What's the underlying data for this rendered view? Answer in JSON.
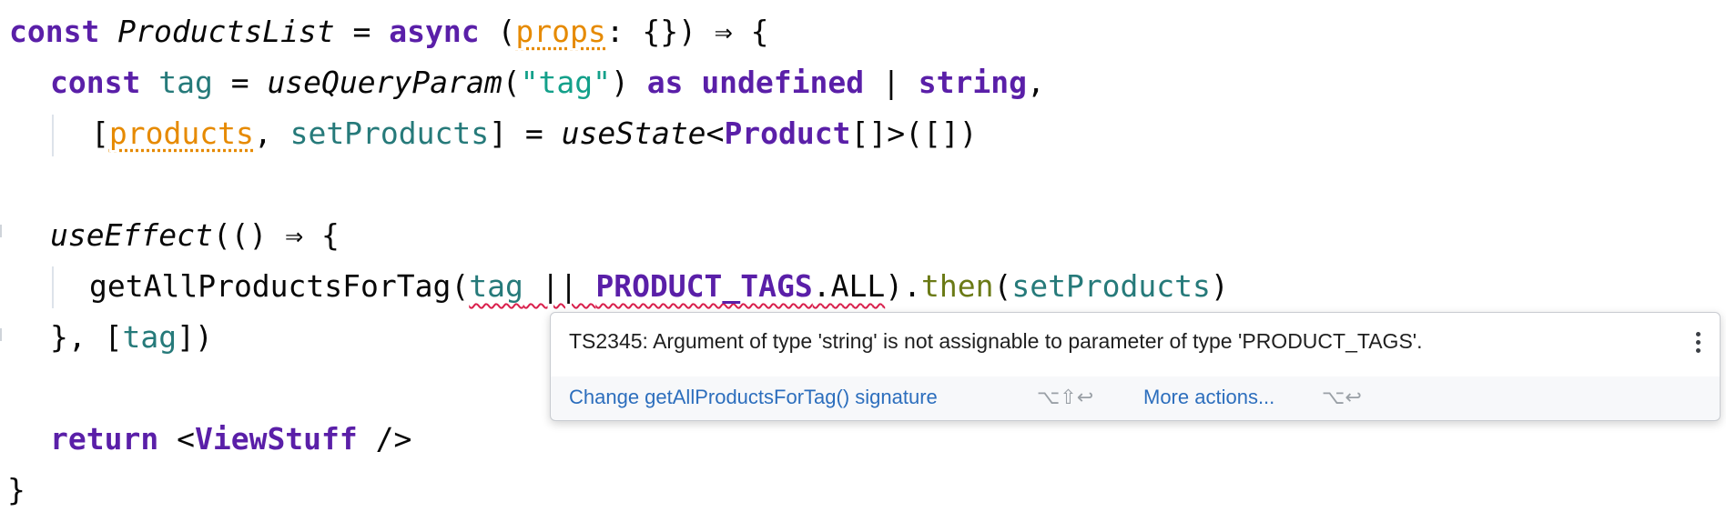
{
  "code": {
    "l1": {
      "kw_const": "const",
      "name": "ProductsList",
      "eq": " = ",
      "kw_async": "async",
      "open": " (",
      "param": "props",
      "rest": ": {}) ⇒ {"
    },
    "l2": {
      "kw_const": "const",
      "var_tag": "tag",
      "eq": " = ",
      "fn": "useQueryParam",
      "open": "(",
      "str": "\"tag\"",
      "close": ") ",
      "kw_as": "as",
      "sp": " ",
      "kw_undefined": "undefined",
      "pipe": " | ",
      "kw_string": "string",
      "comma": ","
    },
    "l3": {
      "open": "[",
      "products": "products",
      "comma": ", ",
      "setProducts": "setProducts",
      "mid": "] = ",
      "fn": "useState",
      "lt": "<",
      "type": "Product",
      "rest": "[]>([])"
    },
    "l5": {
      "fn": "useEffect",
      "rest": "(() ⇒ {"
    },
    "l6": {
      "fn": "getAllProductsForTag",
      "open": "(",
      "tag": "tag",
      "or": " || ",
      "const": "PRODUCT_TAGS",
      "all": ".ALL",
      "close": ").",
      "then": "then",
      "open2": "(",
      "setProducts": "setProducts",
      "close2": ")"
    },
    "l7": {
      "open": "}, [",
      "tag": "tag",
      "close": "])"
    },
    "l9": {
      "kw_return": "return",
      "lt": " <",
      "comp": "ViewStuff",
      "close": " />"
    },
    "l10": {
      "brace": "}"
    }
  },
  "popup": {
    "message": "TS2345: Argument of type 'string' is not assignable to parameter of type 'PRODUCT_TAGS'.",
    "action1": "Change getAllProductsForTag() signature",
    "action1_shortcut": "⌥⇧↩",
    "action2": "More actions...",
    "action2_shortcut": "⌥↩"
  },
  "colors": {
    "keyword": "#5a1fa8",
    "string": "#13a08a",
    "variable": "#267a7a",
    "unused": "#e68a00",
    "method": "#6b7a16",
    "error_underline": "#d9214d",
    "link": "#2c6ebd"
  }
}
